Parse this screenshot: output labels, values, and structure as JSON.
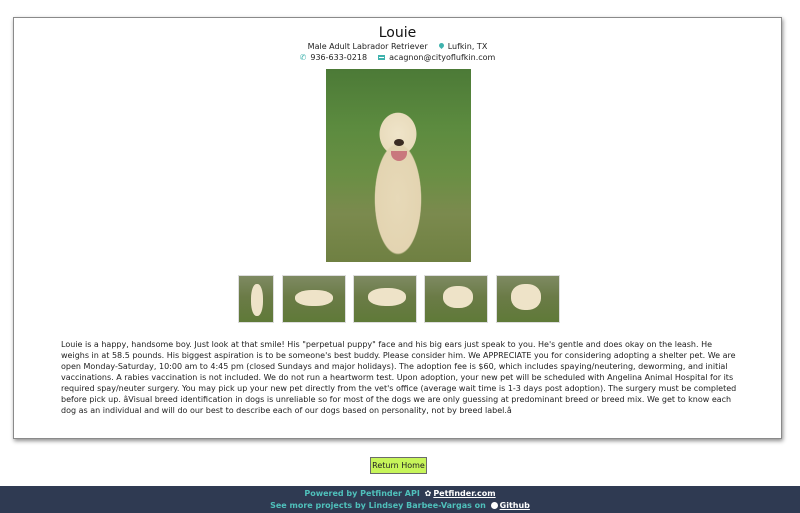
{
  "pet": {
    "name": "Louie",
    "summary": "Male Adult Labrador Retriever",
    "location": "Lufkin, TX",
    "phone": "936-633-0218",
    "email": "acagnon@cityoflufkin.com",
    "description": "Louie is a happy, handsome boy. Just look at that smile! His \"perpetual puppy\" face and his big ears just speak to you. He's gentle and does okay on the leash. He weighs in at 58.5 pounds. His biggest aspiration is to be someone's best buddy. Please consider him. We APPRECIATE you for considering adopting a shelter pet. We are open Monday-Saturday, 10:00 am to 4:45 pm (closed Sundays and major holidays). The adoption fee is $60, which includes spaying/neutering, deworming, and initial vaccinations. A rabies vaccination is not included. We do not run a heartworm test. Upon adoption, your new pet will be scheduled with Angelina Animal Hospital for its required spay/neuter surgery. You may pick up your new pet directly from the vet's office (average wait time is 1-3 days post adoption). The surgery must be completed before pick up. âVisual breed identification in dogs is unreliable so for most of the dogs we are only guessing at predominant breed or breed mix. We get to know each dog as an individual and will do our best to describe each of our dogs based on personality, not by breed label.â"
  },
  "icons": {
    "location": "map-pin-icon",
    "phone": "phone-icon",
    "email": "envelope-icon",
    "paw": "paw-icon",
    "github": "github-icon"
  },
  "photos": {
    "main": "main-dog-photo",
    "thumbnails": [
      "thumb-1",
      "thumb-2",
      "thumb-3",
      "thumb-4",
      "thumb-5"
    ]
  },
  "actions": {
    "return_label": "Return Home"
  },
  "footer": {
    "line1_prefix": "Powered by Petfinder API",
    "line1_link": "Petfinder.com",
    "line2_prefix": "See more projects by Lindsey Barbee-Vargas on",
    "line2_link": "Github"
  },
  "colors": {
    "accent": "#4fc0bb",
    "button": "#c7f55a",
    "footer_bg": "#2f3a52"
  }
}
